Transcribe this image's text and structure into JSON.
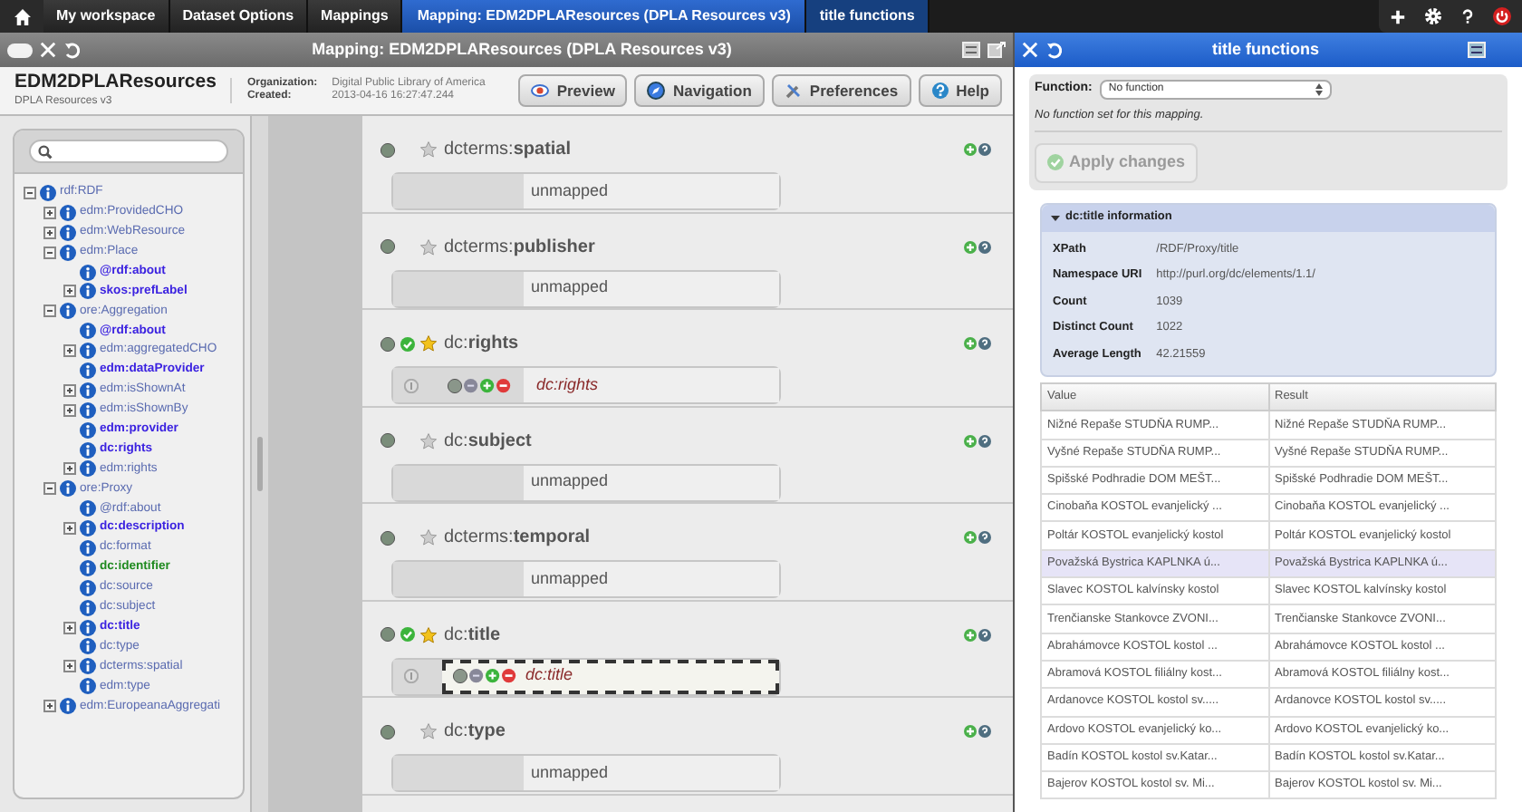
{
  "breadcrumbs": [
    {
      "label": "My workspace",
      "selected": false
    },
    {
      "label": "Dataset Options",
      "selected": false
    },
    {
      "label": "Mappings",
      "selected": false
    },
    {
      "label": "Mapping: EDM2DPLAResources (DPLA Resources v3)",
      "selected": true
    },
    {
      "label": "title functions",
      "selected": false
    }
  ],
  "mapping_window": {
    "title": "Mapping: EDM2DPLAResources (DPLA Resources v3)",
    "name": "EDM2DPLAResources",
    "subtitle": "DPLA Resources v3",
    "meta": [
      {
        "label": "Organization:",
        "value": "Digital Public Library of America"
      },
      {
        "label": "Created:",
        "value": "2013-04-16 16:27:47.244"
      }
    ],
    "buttons": [
      {
        "label": "Preview",
        "kind": "preview"
      },
      {
        "label": "Navigation",
        "kind": "navigation"
      },
      {
        "label": "Preferences",
        "kind": "preferences"
      },
      {
        "label": "Help",
        "kind": "help"
      }
    ],
    "tree": [
      {
        "label": "rdf:RDF",
        "kind": "normal",
        "expanded": true,
        "children": [
          {
            "label": "edm:ProvidedCHO",
            "kind": "normal",
            "expanded": false
          },
          {
            "label": "edm:WebResource",
            "kind": "normal",
            "expanded": false
          },
          {
            "label": "edm:Place",
            "kind": "normal",
            "expanded": true,
            "children": [
              {
                "label": "@rdf:about",
                "kind": "mapped"
              },
              {
                "label": "skos:prefLabel",
                "kind": "mapped",
                "expanded": false
              }
            ]
          },
          {
            "label": "ore:Aggregation",
            "kind": "normal",
            "expanded": true,
            "children": [
              {
                "label": "@rdf:about",
                "kind": "mapped"
              },
              {
                "label": "edm:aggregatedCHO",
                "kind": "normal",
                "expanded": false
              },
              {
                "label": "edm:dataProvider",
                "kind": "mapped"
              },
              {
                "label": "edm:isShownAt",
                "kind": "normal",
                "expanded": false
              },
              {
                "label": "edm:isShownBy",
                "kind": "normal",
                "expanded": false
              },
              {
                "label": "edm:provider",
                "kind": "mapped"
              },
              {
                "label": "dc:rights",
                "kind": "mapped"
              },
              {
                "label": "edm:rights",
                "kind": "normal",
                "expanded": false
              }
            ]
          },
          {
            "label": "ore:Proxy",
            "kind": "normal",
            "expanded": true,
            "children": [
              {
                "label": "@rdf:about",
                "kind": "normal"
              },
              {
                "label": "dc:description",
                "kind": "mapped",
                "expanded": false
              },
              {
                "label": "dc:format",
                "kind": "normal"
              },
              {
                "label": "dc:identifier",
                "kind": "identifier"
              },
              {
                "label": "dc:source",
                "kind": "normal"
              },
              {
                "label": "dc:subject",
                "kind": "normal"
              },
              {
                "label": "dc:title",
                "kind": "mapped",
                "expanded": false
              },
              {
                "label": "dc:type",
                "kind": "normal"
              },
              {
                "label": "dcterms:spatial",
                "kind": "normal",
                "expanded": false
              },
              {
                "label": "edm:type",
                "kind": "normal"
              }
            ]
          },
          {
            "label": "edm:EuropeanaAggregati",
            "kind": "normal",
            "expanded": false
          }
        ]
      }
    ],
    "elements": [
      {
        "name": "dcterms:**spatial**",
        "mapped": false,
        "value": "unmapped",
        "selected": false
      },
      {
        "name": "dcterms:**publisher**",
        "mapped": false,
        "value": "unmapped",
        "selected": false
      },
      {
        "name": "dc:**rights**",
        "mapped": true,
        "value": "dc:rights",
        "selected": false
      },
      {
        "name": "dc:**subject**",
        "mapped": false,
        "value": "unmapped",
        "selected": false
      },
      {
        "name": "dcterms:**temporal**",
        "mapped": false,
        "value": "unmapped",
        "selected": false
      },
      {
        "name": "dc:**title**",
        "mapped": true,
        "value": "dc:title",
        "selected": true
      },
      {
        "name": "dc:**type**",
        "mapped": false,
        "value": "unmapped",
        "selected": false
      }
    ]
  },
  "functions_window": {
    "title": "title functions",
    "function_label": "Function:",
    "function_value": "No function",
    "message": "No function set for this mapping.",
    "apply_button": {
      "label": "Apply changes",
      "disabled": true
    },
    "info": {
      "title": "dc:title information",
      "expanded": true,
      "rows": [
        {
          "key": "XPath",
          "value": "/RDF/Proxy/title"
        },
        {
          "key": "Namespace URI",
          "value": "http://purl.org/dc/elements/1.1/"
        },
        {
          "key": "Count",
          "value": "1039"
        },
        {
          "key": "Distinct Count",
          "value": "1022"
        },
        {
          "key": "Average Length",
          "value": "42.21559"
        }
      ]
    },
    "table": {
      "columns": [
        "Value",
        "Result"
      ],
      "rows": [
        {
          "cells": [
            "Nižné Repaše STUDŇA RUMP...",
            "Nižné Repaše STUDŇA RUMP..."
          ],
          "selected": false
        },
        {
          "cells": [
            "Vyšné Repaše STUDŇA RUMP...",
            "Vyšné Repaše STUDŇA RUMP..."
          ],
          "selected": false
        },
        {
          "cells": [
            "Spišské Podhradie DOM MEŠT...",
            "Spišské Podhradie DOM MEŠT..."
          ],
          "selected": false
        },
        {
          "cells": [
            "Cinobaňa KOSTOL evanjelický ...",
            "Cinobaňa KOSTOL evanjelický ..."
          ],
          "selected": false
        },
        {
          "cells": [
            "Poltár KOSTOL evanjelický kostol",
            "Poltár KOSTOL evanjelický kostol"
          ],
          "selected": false
        },
        {
          "cells": [
            "Považská Bystrica KAPLNKA ú...",
            "Považská Bystrica KAPLNKA ú..."
          ],
          "selected": true
        },
        {
          "cells": [
            "Slavec KOSTOL kalvínsky kostol",
            "Slavec KOSTOL kalvínsky kostol"
          ],
          "selected": false
        },
        {
          "cells": [
            "Trenčianske Stankovce ZVONI...",
            "Trenčianske Stankovce ZVONI..."
          ],
          "selected": false
        },
        {
          "cells": [
            "Abrahámovce KOSTOL kostol ...",
            "Abrahámovce KOSTOL kostol ..."
          ],
          "selected": false
        },
        {
          "cells": [
            "Abramová KOSTOL filiálny kost...",
            "Abramová KOSTOL filiálny kost..."
          ],
          "selected": false
        },
        {
          "cells": [
            "Ardanovce KOSTOL kostol sv.....",
            "Ardanovce KOSTOL kostol sv....."
          ],
          "selected": false
        },
        {
          "cells": [
            "Ardovo KOSTOL evanjelický ko...",
            "Ardovo KOSTOL evanjelický ko..."
          ],
          "selected": false
        },
        {
          "cells": [
            "Badín KOSTOL kostol sv.Katar...",
            "Badín KOSTOL kostol sv.Katar..."
          ],
          "selected": false
        },
        {
          "cells": [
            "Bajerov KOSTOL kostol sv. Mi...",
            "Bajerov KOSTOL kostol sv. Mi..."
          ],
          "selected": false
        }
      ]
    }
  }
}
